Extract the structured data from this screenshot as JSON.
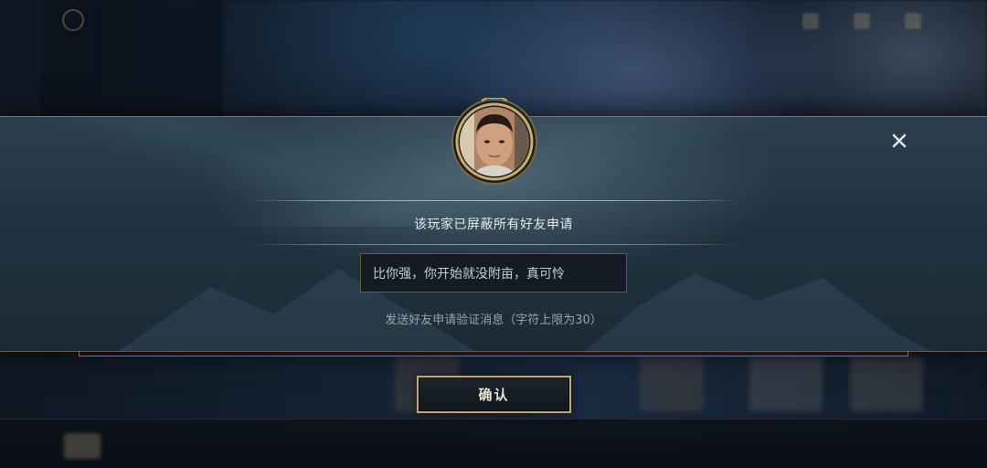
{
  "modal": {
    "status_text": "该玩家已屏蔽所有好友申请",
    "message_input_value": "比你强，你开始就没附亩，真可怜",
    "hint_text": "发送好友申请验证消息（字符上限为30）",
    "confirm_label": "确认"
  },
  "colors": {
    "gold_accent": "#c4a769",
    "modal_bg": "#213341",
    "text_primary": "#e6e9ec",
    "text_hint": "#9aa4ad"
  }
}
